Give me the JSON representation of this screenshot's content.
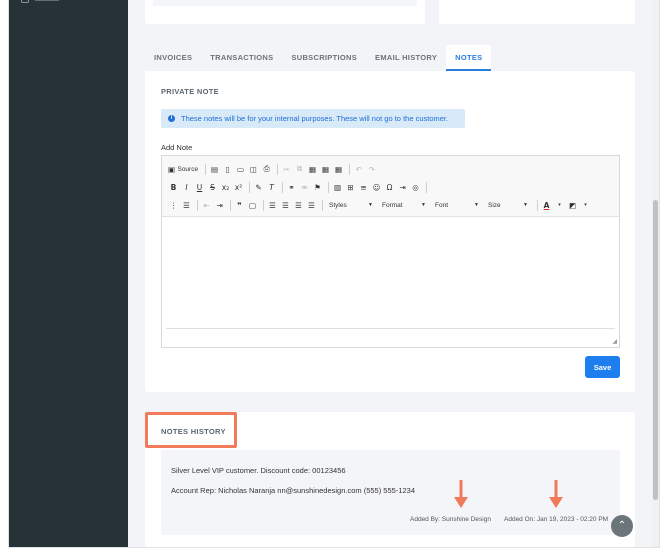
{
  "tabs": [
    {
      "label": "INVOICES"
    },
    {
      "label": "TRANSACTIONS"
    },
    {
      "label": "SUBSCRIPTIONS"
    },
    {
      "label": "EMAIL HISTORY"
    },
    {
      "label": "NOTES"
    }
  ],
  "private_note": {
    "title": "PRIVATE NOTE",
    "info_text": "These notes will be for your internal purposes. These will not go to the customer.",
    "add_note_label": "Add Note"
  },
  "editor": {
    "source_label": "Source",
    "styles_label": "Styles",
    "format_label": "Format",
    "font_label": "Font",
    "size_label": "Size"
  },
  "save_label": "Save",
  "notes_history": {
    "title": "NOTES HISTORY",
    "line1": "Silver Level VIP customer. Discount code: 00123456",
    "line2": "Account Rep: Nicholas Naranja  nn@sunshinedesign.com  (555) 555-1234",
    "added_by": "Added By: Sunshine Design",
    "added_on": "Added On: Jan 19, 2023 - 02:20 PM"
  },
  "colors": {
    "accent": "#1e7ef0",
    "highlight": "#f07a5a",
    "sidebar": "#273238"
  }
}
